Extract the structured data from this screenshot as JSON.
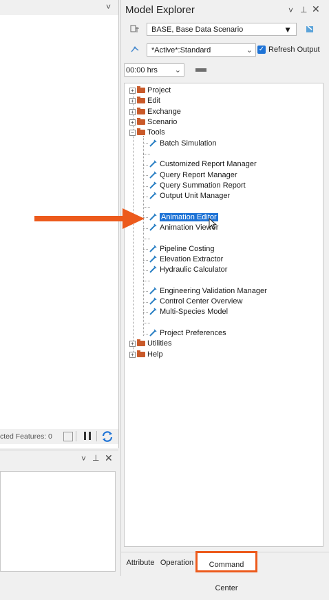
{
  "left_pane": {
    "status_text": "cted Features: 0",
    "chevron": "˅"
  },
  "model_explorer": {
    "title": "Model Explorer",
    "scenario_value": "BASE, Base Data Scenario",
    "active_value": "*Active*:Standard",
    "refresh_output_label": "Refresh Output",
    "refresh_output_checked": true,
    "time_value": "00:00 hrs"
  },
  "tree": {
    "top_groups": [
      "Project",
      "Edit",
      "Exchange",
      "Scenario"
    ],
    "tools_label": "Tools",
    "tools_items": [
      "Batch Simulation",
      "Customized Report Manager",
      "Query Report Manager",
      "Query Summation Report",
      "Output Unit Manager",
      "Animation Editor",
      "Animation Viewer",
      "Pipeline Costing",
      "Elevation Extractor",
      "Hydraulic Calculator",
      "Engineering Validation Manager",
      "Control Center Overview",
      "Multi-Species Model",
      "Project Preferences"
    ],
    "selected_item": "Animation Editor",
    "bottom_groups": [
      "Utilities",
      "Help"
    ]
  },
  "tabs": [
    "Attribute",
    "Operation",
    "Command Center"
  ],
  "colors": {
    "selection": "#1e73d6",
    "annotation_orange": "#ec5a1c",
    "folder": "#c95a2a",
    "tool_icon": "#2a7fc4"
  }
}
